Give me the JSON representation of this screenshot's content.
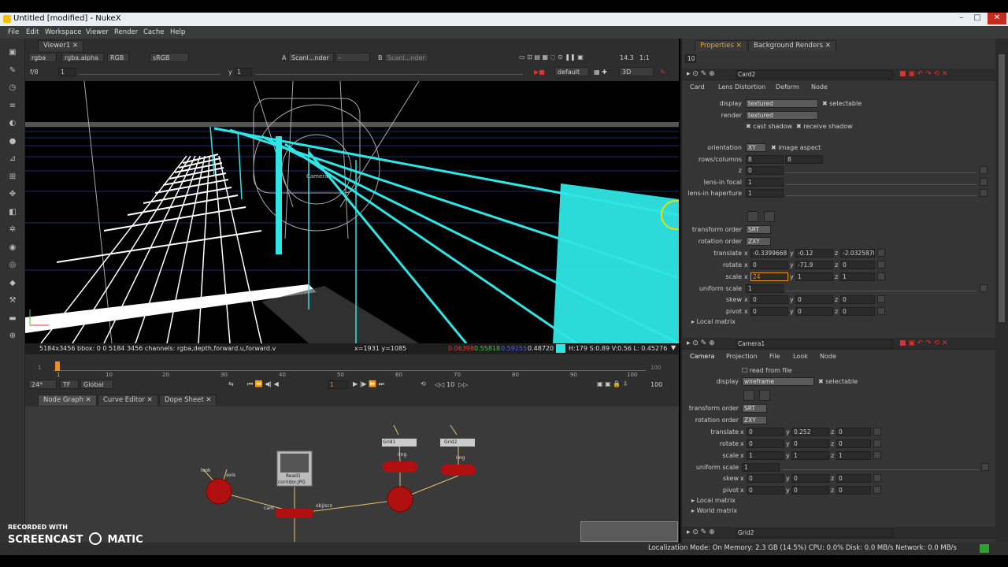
{
  "window": {
    "title": "Untitled [modified] - NukeX",
    "minimize": "–",
    "maximize": "□",
    "close": "✕"
  },
  "menus": [
    "File",
    "Edit",
    "Workspace",
    "Viewer",
    "Render",
    "Cache",
    "Help"
  ],
  "viewer": {
    "tab": "Viewer1",
    "channels": "rgba",
    "alpha": "rgba.alpha",
    "colorspace_rgb": "RGB",
    "lut": "sRGB",
    "input_a": "Scanl...nder",
    "input_a_label": "A",
    "dash": "-",
    "input_b": "Scanl...nder",
    "input_b_label": "B",
    "zoom": "14.3",
    "ratio": "1:1",
    "fstop": "f/8",
    "frame_field": "1",
    "y_label": "y",
    "y_value": "1",
    "cam_mode": "default",
    "view_mode": "3D",
    "camera_label": "Camera1",
    "status": "5184x3456  bbox: 0 0 5184 3456 channels: rgba,depth,forward.u,forward.v",
    "coords": "x=1931 y=1085",
    "pixel_r": "0.06398",
    "pixel_g": "0.55818",
    "pixel_b": "0.59255",
    "pixel_a": "0.48720",
    "hsv": "H:179 S:0.89 V:0.56  L: 0.45276"
  },
  "timeline": {
    "start": "1",
    "end": "100",
    "ticks": [
      "1",
      "10",
      "20",
      "30",
      "40",
      "50",
      "60",
      "70",
      "80",
      "90",
      "100"
    ],
    "fps": "24*",
    "tf": "TF",
    "global": "Global",
    "current_frame": "1",
    "step": "10",
    "end_field": "100"
  },
  "nodegraph": {
    "tabs": [
      "Node Graph",
      "Curve Editor",
      "Dope Sheet"
    ],
    "nodes": {
      "read1": "Read1",
      "read1_file": "corridor.JPG",
      "grid1": "Grid1",
      "grid2": "Grid2",
      "look": "look",
      "axis": "axis",
      "img": "img",
      "cam": "cam",
      "obj_scn": "obj/scn"
    }
  },
  "properties": {
    "tabs": [
      "Properties",
      "Background Renders"
    ],
    "max_panels": "10",
    "card2": {
      "name": "Card2",
      "subtabs": [
        "Card",
        "Lens Distortion",
        "Deform",
        "Node"
      ],
      "display_label": "display",
      "display": "textured",
      "selectable": "selectable",
      "render_label": "render",
      "render": "textured",
      "cast_shadow": "cast shadow",
      "receive_shadow": "receive shadow",
      "orientation_label": "orientation",
      "orientation": "XY",
      "image_aspect": "image aspect",
      "rows_label": "rows/columns",
      "rows": "8",
      "columns": "8",
      "z_label": "z",
      "z": "0",
      "lensin_focal_label": "lens-in focal",
      "lensin_focal": "1",
      "lensin_haperture_label": "lens-in haperture",
      "lensin_haperture": "1",
      "transform_order_label": "transform order",
      "transform_order": "SRT",
      "rotation_order_label": "rotation order",
      "rotation_order": "ZXY",
      "translate_label": "translate",
      "translate": [
        "-0.3399668",
        "-0.12",
        "-2.0325870"
      ],
      "rotate_label": "rotate",
      "rotate": [
        "0",
        "-71.9",
        "0"
      ],
      "scale_label": "scale",
      "scale": [
        "24",
        "1",
        "1"
      ],
      "uniform_scale_label": "uniform scale",
      "uniform_scale": "1",
      "skew_label": "skew",
      "skew": [
        "0",
        "0",
        "0"
      ],
      "pivot_label": "pivot",
      "pivot": [
        "0",
        "0",
        "0"
      ],
      "local_matrix": "Local matrix"
    },
    "camera1": {
      "name": "Camera1",
      "subtabs": [
        "Camera",
        "Projection",
        "File",
        "Look",
        "Node"
      ],
      "read_from_file": "read from file",
      "display_label": "display",
      "display": "wireframe",
      "selectable": "selectable",
      "transform_order_label": "transform order",
      "transform_order": "SRT",
      "rotation_order_label": "rotation order",
      "rotation_order": "ZXY",
      "translate_label": "translate",
      "translate": [
        "0",
        "0.252",
        "0"
      ],
      "rotate_label": "rotate",
      "rotate": [
        "0",
        "0",
        "0"
      ],
      "scale_label": "scale",
      "scale": [
        "1",
        "1",
        "1"
      ],
      "uniform_scale_label": "uniform scale",
      "uniform_scale": "1",
      "skew_label": "skew",
      "skew": [
        "0",
        "0",
        "0"
      ],
      "pivot_label": "pivot",
      "pivot": [
        "0",
        "0",
        "0"
      ],
      "local_matrix": "Local matrix",
      "world_matrix": "World matrix"
    },
    "grid2": {
      "name": "Grid2"
    }
  },
  "axes": {
    "x": "x",
    "y": "y",
    "z": "z"
  },
  "status_bar": "Localization Mode: On Memory: 2.3 GB (14.5%) CPU: 0.0% Disk: 0.0 MB/s Network: 0.0 MB/s",
  "watermark": {
    "line1": "RECORDED WITH",
    "line2": "SCREENCAST",
    "line3": "MATIC"
  },
  "colors": {
    "cyan": "#2ee6e6",
    "node_red": "#b01010",
    "panel_bg": "#353535"
  }
}
